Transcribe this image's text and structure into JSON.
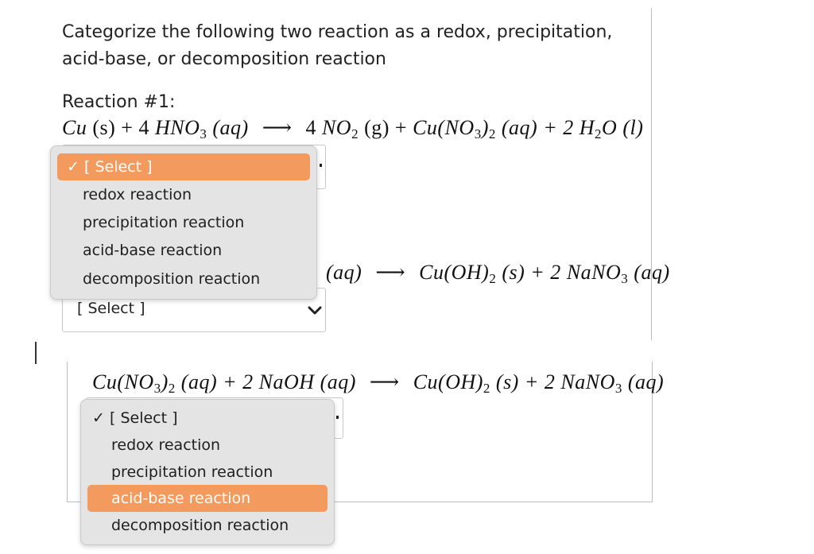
{
  "question": {
    "line1": "Categorize the following two reaction as a redox, precipitation,",
    "line2": "acid-base, or decomposition reaction"
  },
  "reaction1": {
    "label": "Reaction #1:",
    "equation": {
      "lhs_a": "Cu",
      "lhs_b": "(s) + 4",
      "lhs_c": "HNO",
      "lhs_c_sub": "3",
      "lhs_d": "(aq)",
      "arrow": "⟶",
      "rhs_a": "4",
      "rhs_b": "NO",
      "rhs_b_sub": "2",
      "rhs_c": "(g) +",
      "rhs_d": "Cu(NO",
      "rhs_d_sub": "3",
      "rhs_e": ")",
      "rhs_e_sub": "2",
      "rhs_f": "(aq) + 2",
      "rhs_g": "H",
      "rhs_g_sub": "2",
      "rhs_h": "O",
      "rhs_i": "(l)"
    },
    "dropdown": {
      "check": "✓",
      "options": [
        "[ Select ]",
        "redox reaction",
        "precipitation reaction",
        "acid-base reaction",
        "decomposition reaction"
      ],
      "highlighted_index": 0
    }
  },
  "reaction2_partial": {
    "lhs_tail": "(aq)",
    "arrow": "⟶",
    "rhs_a": "Cu(OH)",
    "rhs_a_sub": "2",
    "rhs_b": "(s) + 2",
    "rhs_c": "NaNO",
    "rhs_c_sub": "3",
    "rhs_d": "(aq)",
    "select_value": "[ Select ]"
  },
  "reaction2": {
    "equation": {
      "a": "Cu(NO",
      "a_sub": "3",
      "b": ")",
      "b_sub": "2",
      "c": "(aq) + 2",
      "d": "NaOH",
      "e": "(aq)",
      "arrow": "⟶",
      "f": "Cu(OH)",
      "f_sub": "2",
      "g": "(s) + 2",
      "h": "NaNO",
      "h_sub": "3",
      "i": "(aq)"
    },
    "dropdown": {
      "check": "✓",
      "options": [
        "[ Select ]",
        "redox reaction",
        "precipitation reaction",
        "acid-base reaction",
        "decomposition reaction"
      ],
      "highlighted_index": 3
    }
  },
  "colors": {
    "highlight": "#f39a5e",
    "menu_bg": "#e4e4e4"
  }
}
